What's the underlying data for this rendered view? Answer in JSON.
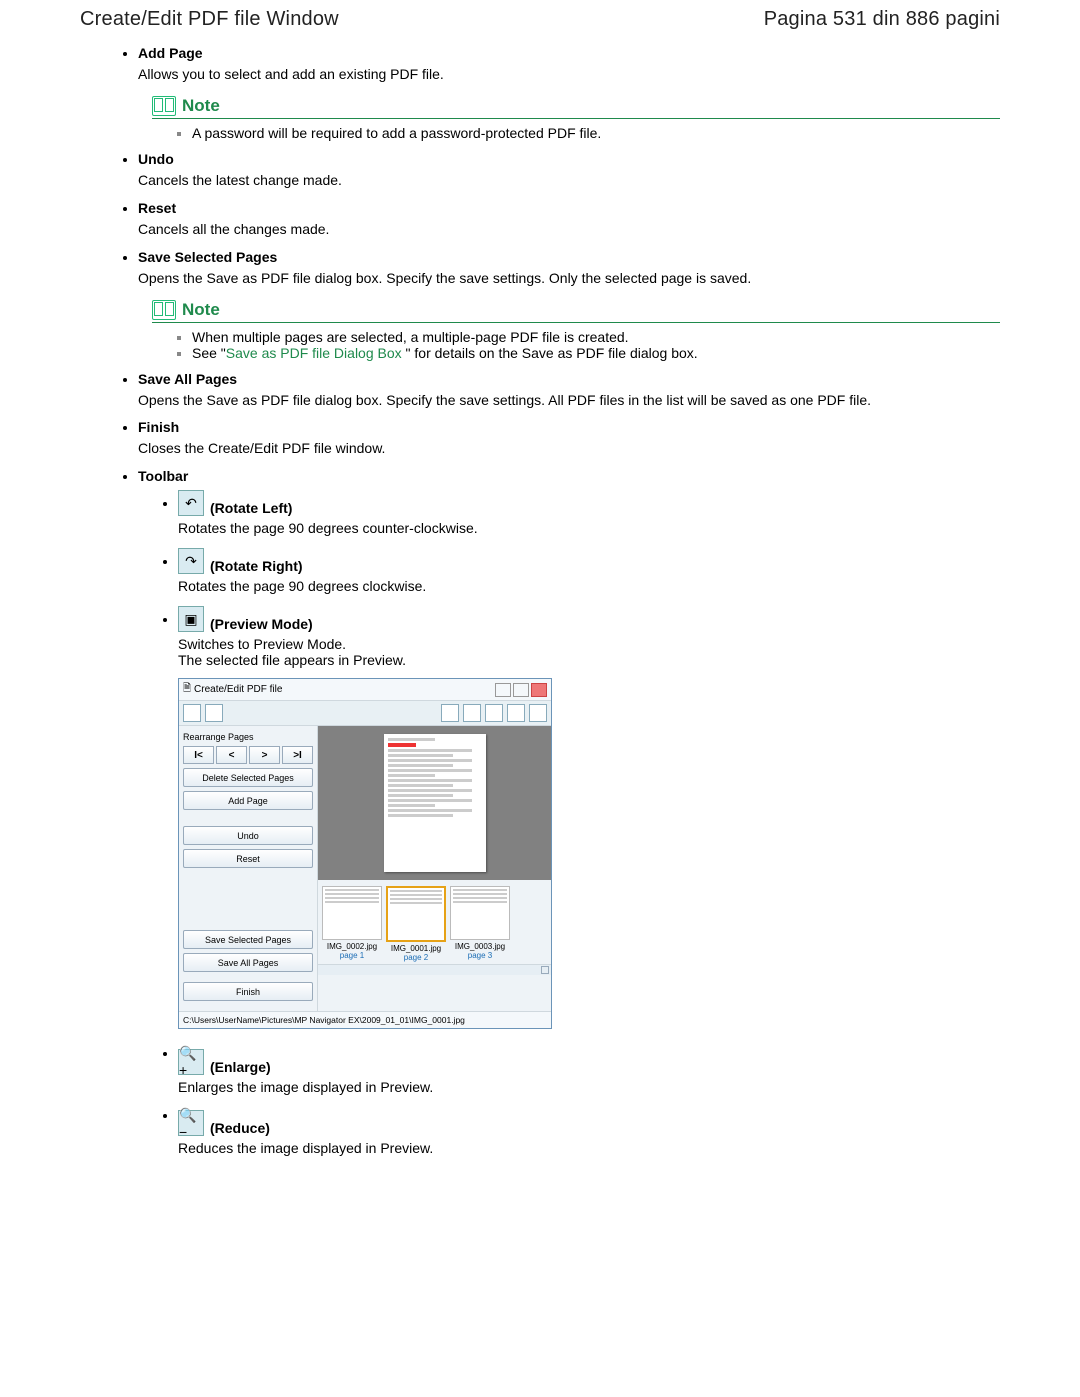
{
  "header": {
    "title": "Create/Edit PDF file Window",
    "page_info": "Pagina 531 din 886 pagini"
  },
  "items": {
    "add_page": {
      "title": "Add Page",
      "desc": "Allows you to select and add an existing PDF file."
    },
    "undo": {
      "title": "Undo",
      "desc": "Cancels the latest change made."
    },
    "reset": {
      "title": "Reset",
      "desc": "Cancels all the changes made."
    },
    "save_selected": {
      "title": "Save Selected Pages",
      "desc": "Opens the Save as PDF file dialog box. Specify the save settings. Only the selected page is saved."
    },
    "save_all": {
      "title": "Save All Pages",
      "desc": "Opens the Save as PDF file dialog box. Specify the save settings. All PDF files in the list will be saved as one PDF file."
    },
    "finish": {
      "title": "Finish",
      "desc": "Closes the Create/Edit PDF file window."
    },
    "toolbar": {
      "title": "Toolbar"
    }
  },
  "note1": {
    "heading": "Note",
    "line1": "A password will be required to add a password-protected PDF file."
  },
  "note2": {
    "heading": "Note",
    "line1": "When multiple pages are selected, a multiple-page PDF file is created.",
    "line2_prefix": "See \"",
    "line2_link": "Save as PDF file Dialog Box ",
    "line2_suffix": "\" for details on the Save as PDF file dialog box."
  },
  "toolbar_items": {
    "rotate_left": {
      "title": " (Rotate Left)",
      "desc": "Rotates the page 90 degrees counter-clockwise."
    },
    "rotate_right": {
      "title": " (Rotate Right)",
      "desc": "Rotates the page 90 degrees clockwise."
    },
    "preview": {
      "title": " (Preview Mode)",
      "desc": "Switches to Preview Mode.",
      "desc2": "The selected file appears in Preview."
    },
    "enlarge": {
      "title": " (Enlarge)",
      "desc": "Enlarges the image displayed in Preview."
    },
    "reduce": {
      "title": " (Reduce)",
      "desc": "Reduces the image displayed in Preview."
    }
  },
  "screenshot": {
    "title": "Create/Edit PDF file",
    "rearrange": "Rearrange Pages",
    "nav": {
      "first": "I<",
      "prev": "<",
      "next": ">",
      "last": ">I"
    },
    "btn_delete": "Delete Selected Pages",
    "btn_add": "Add Page",
    "btn_undo": "Undo",
    "btn_reset": "Reset",
    "btn_save_sel": "Save Selected Pages",
    "btn_save_all": "Save All Pages",
    "btn_finish": "Finish",
    "thumbs": [
      {
        "file": "IMG_0002.jpg",
        "page": "page 1"
      },
      {
        "file": "IMG_0001.jpg",
        "page": "page 2"
      },
      {
        "file": "IMG_0003.jpg",
        "page": "page 3"
      }
    ],
    "path": "C:\\Users\\UserName\\Pictures\\MP Navigator EX\\2009_01_01\\IMG_0001.jpg"
  }
}
